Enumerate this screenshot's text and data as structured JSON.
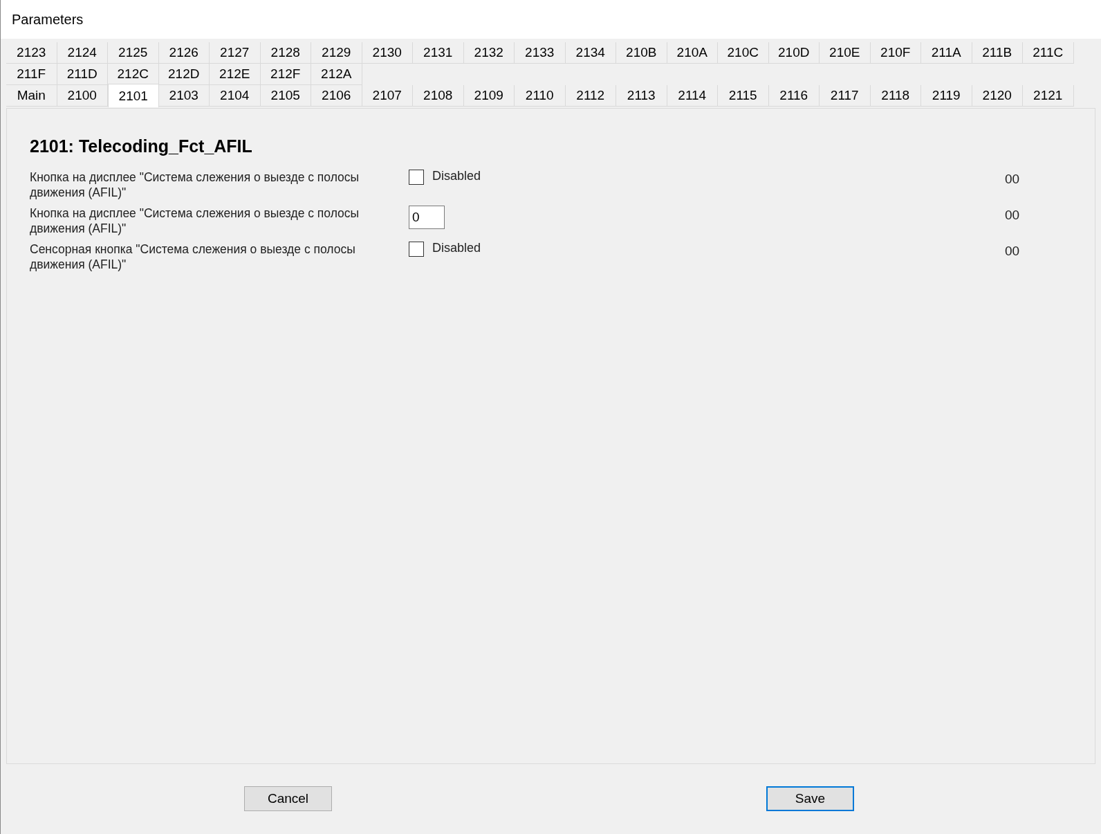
{
  "window": {
    "title": "Parameters"
  },
  "tab_rows": [
    {
      "tabs": [
        {
          "label": "2123",
          "selected": false
        },
        {
          "label": "2124",
          "selected": false
        },
        {
          "label": "2125",
          "selected": false
        },
        {
          "label": "2126",
          "selected": false
        },
        {
          "label": "2127",
          "selected": false
        },
        {
          "label": "2128",
          "selected": false
        },
        {
          "label": "2129",
          "selected": false
        },
        {
          "label": "2130",
          "selected": false
        },
        {
          "label": "2131",
          "selected": false
        },
        {
          "label": "2132",
          "selected": false
        },
        {
          "label": "2133",
          "selected": false
        },
        {
          "label": "2134",
          "selected": false
        },
        {
          "label": "210B",
          "selected": false
        },
        {
          "label": "210A",
          "selected": false
        },
        {
          "label": "210C",
          "selected": false
        },
        {
          "label": "210D",
          "selected": false
        },
        {
          "label": "210E",
          "selected": false
        },
        {
          "label": "210F",
          "selected": false
        },
        {
          "label": "211A",
          "selected": false
        },
        {
          "label": "211B",
          "selected": false
        },
        {
          "label": "211C",
          "selected": false
        }
      ]
    },
    {
      "tabs": [
        {
          "label": "211F",
          "selected": false
        },
        {
          "label": "211D",
          "selected": false
        },
        {
          "label": "212C",
          "selected": false
        },
        {
          "label": "212D",
          "selected": false
        },
        {
          "label": "212E",
          "selected": false
        },
        {
          "label": "212F",
          "selected": false
        },
        {
          "label": "212A",
          "selected": false
        }
      ]
    },
    {
      "tabs": [
        {
          "label": "Main",
          "selected": false
        },
        {
          "label": "2100",
          "selected": false
        },
        {
          "label": "2101",
          "selected": true
        },
        {
          "label": "2103",
          "selected": false
        },
        {
          "label": "2104",
          "selected": false
        },
        {
          "label": "2105",
          "selected": false
        },
        {
          "label": "2106",
          "selected": false
        },
        {
          "label": "2107",
          "selected": false
        },
        {
          "label": "2108",
          "selected": false
        },
        {
          "label": "2109",
          "selected": false
        },
        {
          "label": "2110",
          "selected": false
        },
        {
          "label": "2112",
          "selected": false
        },
        {
          "label": "2113",
          "selected": false
        },
        {
          "label": "2114",
          "selected": false
        },
        {
          "label": "2115",
          "selected": false
        },
        {
          "label": "2116",
          "selected": false
        },
        {
          "label": "2117",
          "selected": false
        },
        {
          "label": "2118",
          "selected": false
        },
        {
          "label": "2119",
          "selected": false
        },
        {
          "label": "2120",
          "selected": false
        },
        {
          "label": "2121",
          "selected": false
        }
      ]
    }
  ],
  "panel": {
    "heading": "2101: Telecoding_Fct_AFIL",
    "fields": [
      {
        "kind": "checkbox",
        "label": "Кнопка на дисплее \"Система слежения о выезде с полосы движения (AFIL)\"",
        "checked": false,
        "option": "Disabled",
        "value": "00"
      },
      {
        "kind": "text",
        "label": "Кнопка на дисплее \"Система слежения о выезде с полосы движения (AFIL)\"",
        "input": "0",
        "value": "00"
      },
      {
        "kind": "checkbox",
        "label": "Сенсорная кнопка \"Система слежения о выезде с полосы движения (AFIL)\"",
        "checked": false,
        "option": "Disabled",
        "value": "00"
      }
    ]
  },
  "buttons": [
    {
      "label": "Cancel",
      "focused": false
    },
    {
      "label": "Save",
      "focused": true
    }
  ]
}
